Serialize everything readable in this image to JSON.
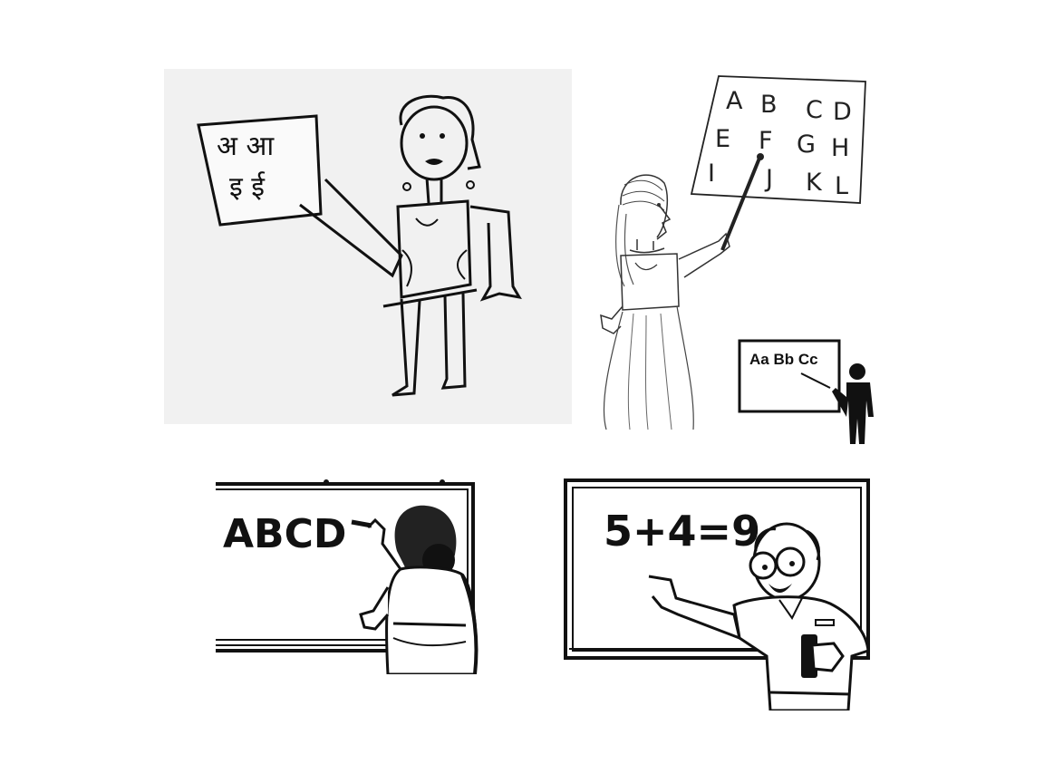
{
  "panels": {
    "hindi_chart": {
      "row1": "अ आ",
      "row2": "इ ई"
    },
    "alphabet_chart": {
      "row1": [
        "A",
        "B",
        "C",
        "D"
      ],
      "row2": [
        "E",
        "F",
        "G",
        "H"
      ],
      "row3": [
        "I",
        "J",
        "K",
        "L"
      ]
    },
    "board_abcd": {
      "text": "ABCD"
    },
    "board_math": {
      "text": "5+4=9"
    },
    "icon_board": {
      "text": "Aa Bb Cc"
    }
  }
}
